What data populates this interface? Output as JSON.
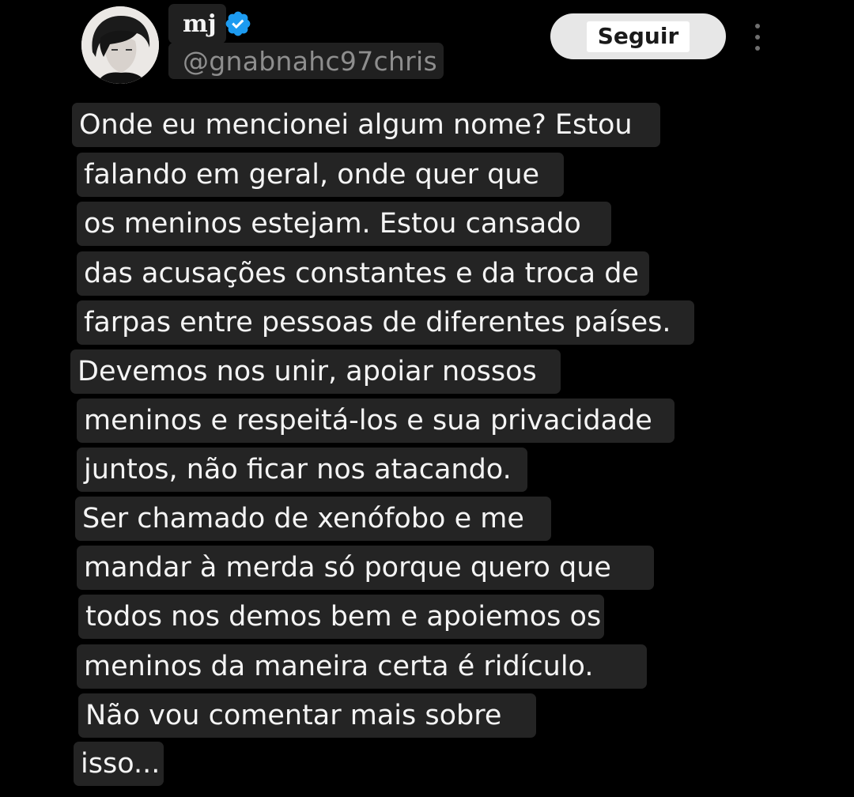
{
  "user": {
    "display_name": "mj",
    "handle": "@gnabnahc97chris",
    "verified": true
  },
  "follow_button": {
    "label": "Seguir"
  },
  "more_icon": "more-vertical-icon",
  "colors": {
    "background": "#000000",
    "caption_box": "#242424",
    "verified_blue": "#1d9bf0",
    "handle_gray": "#8e8e8e"
  },
  "body_lines": [
    "Onde eu mencionei algum nome? Estou",
    "falando em geral, onde quer que",
    "os meninos estejam. Estou cansado",
    "das acusações constantes e da troca de",
    "farpas entre pessoas de diferentes países.",
    "Devemos nos unir, apoiar nossos",
    "meninos e respeitá-los e sua privacidade",
    "juntos, não ficar nos atacando.",
    "Ser chamado de xenófobo e me",
    "mandar à merda só porque quero que",
    "todos nos demos bem e apoiemos os",
    "meninos da maneira certa é ridículo.",
    "Não vou comentar mais sobre",
    "isso..."
  ]
}
